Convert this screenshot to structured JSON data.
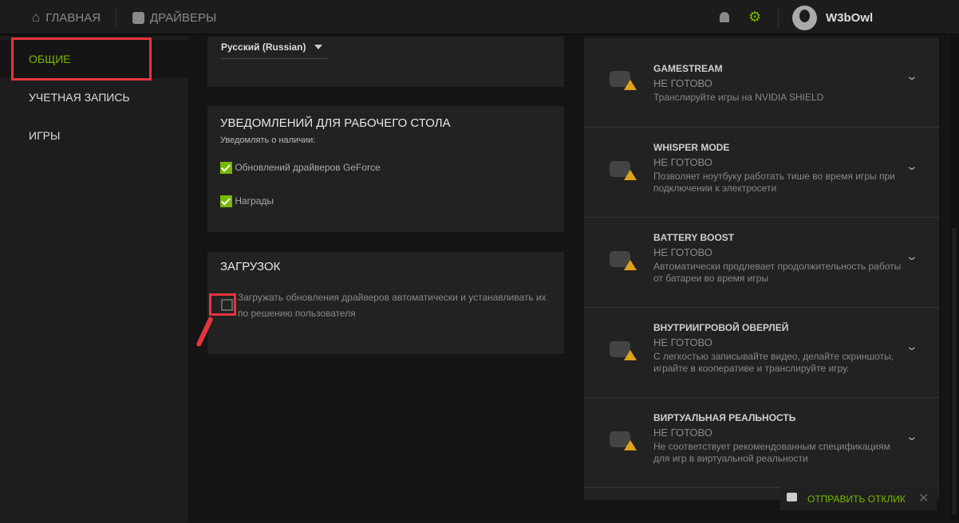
{
  "header": {
    "home": "ГЛАВНАЯ",
    "drivers": "ДРАЙВЕРЫ",
    "username": "W3bOwl"
  },
  "sidebar": {
    "items": [
      {
        "label": "ОБЩИЕ"
      },
      {
        "label": "УЧЕТНАЯ ЗАПИСЬ"
      },
      {
        "label": "ИГРЫ"
      }
    ]
  },
  "language": {
    "selected": "Русский (Russian)"
  },
  "notifications": {
    "title": "УВЕДОМЛЕНИЙ ДЛЯ РАБОЧЕГО СТОЛА",
    "subtitle": "Уведомлять о наличии:",
    "options": [
      {
        "label": "Обновлений драйверов GeForce",
        "checked": true
      },
      {
        "label": "Награды",
        "checked": true
      }
    ]
  },
  "downloads": {
    "title": "ЗАГРУЗОК",
    "option": {
      "label": "Загружать обновления драйверов автоматически и устанавливать их по решению пользователя",
      "checked": false
    }
  },
  "features": [
    {
      "name": "GAMESTREAM",
      "status": "НЕ ГОТОВО",
      "desc": "Транслируйте игры на NVIDIA SHIELD"
    },
    {
      "name": "WHISPER MODE",
      "status": "НЕ ГОТОВО",
      "desc": "Позволяет ноутбуку работать тише во время игры при подключении к электросети"
    },
    {
      "name": "BATTERY BOOST",
      "status": "НЕ ГОТОВО",
      "desc": "Автоматически продлевает продолжительность работы от батареи во время игры"
    },
    {
      "name": "ВНУТРИИГРОВОЙ ОВЕРЛЕЙ",
      "status": "НЕ ГОТОВО",
      "desc": "С легкостью записывайте видео, делайте скриншоты, играйте в кооперативе и транслируйте игру."
    },
    {
      "name": "ВИРТУАЛЬНАЯ РЕАЛЬНОСТЬ",
      "status": "НЕ ГОТОВО",
      "desc": "Не соответствует рекомендованным спецификациям для игр в виртуальной реальности"
    }
  ],
  "feedback": {
    "label": "ОТПРАВИТЬ ОТКЛИК"
  },
  "colors": {
    "accent": "#76b900",
    "highlight": "#e8343f",
    "warning": "#e0a21c"
  }
}
